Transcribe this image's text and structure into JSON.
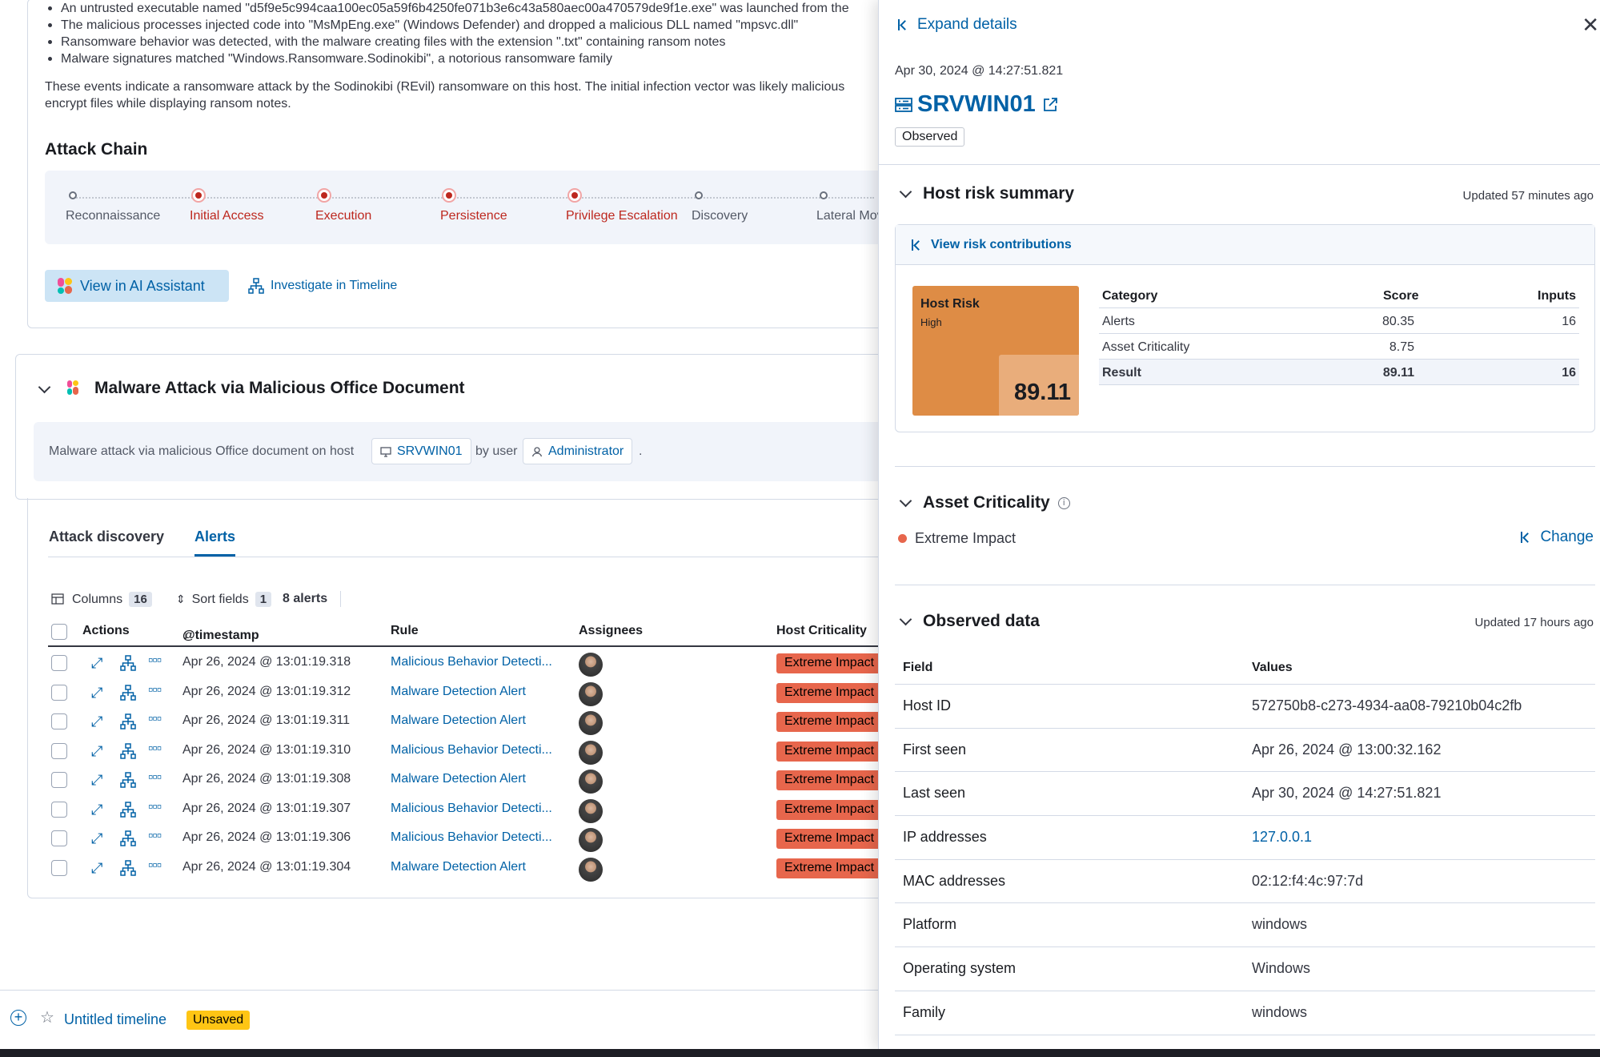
{
  "summary": {
    "bullets": [
      "An untrusted executable named \"d5f9e5c994caa100ec05a59f6b4250fe071b3e6c43a580aec00a470579de9f1e.exe\" was launched from the",
      "The malicious processes injected code into \"MsMpEng.exe\" (Windows Defender) and dropped a malicious DLL named \"mpsvc.dll\"",
      "Ransomware behavior was detected, with the malware creating files with the extension \".txt\" containing ransom notes",
      "Malware signatures matched \"Windows.Ransomware.Sodinokibi\", a notorious ransomware family"
    ],
    "para_line1": "These events indicate a ransomware attack by the Sodinokibi (REvil) ransomware on this host. The initial infection vector was likely malicious",
    "para_line2": "encrypt files while displaying ransom notes."
  },
  "attack_chain": {
    "title": "Attack Chain",
    "stages": [
      {
        "label": "Reconnaissance",
        "active": false
      },
      {
        "label": "Initial Access",
        "active": true
      },
      {
        "label": "Execution",
        "active": true
      },
      {
        "label": "Persistence",
        "active": true
      },
      {
        "label": "Privilege Escalation",
        "active": true
      },
      {
        "label": "Discovery",
        "active": false
      },
      {
        "label": "Lateral Movement",
        "active": false
      }
    ]
  },
  "actions": {
    "ai_assistant": "View in AI Assistant",
    "timeline": "Investigate in Timeline"
  },
  "discovery": {
    "title": "Malware Attack via Malicious Office Document",
    "text_prefix": "Malware attack via malicious Office document on host",
    "host": "SRVWIN01",
    "by_user": "by user",
    "user": "Administrator",
    "text_suffix": "."
  },
  "tabs": {
    "attack_discovery": "Attack discovery",
    "alerts": "Alerts"
  },
  "toolbar": {
    "columns_label": "Columns",
    "columns_count": "16",
    "sort_label": "Sort fields",
    "sort_count": "1",
    "alerts_count": "8 alerts"
  },
  "table": {
    "headers": {
      "actions": "Actions",
      "timestamp": "@timestamp",
      "rule": "Rule",
      "assignees": "Assignees",
      "host_criticality": "Host Criticality"
    },
    "rows": [
      {
        "timestamp": "Apr 26, 2024 @ 13:01:19.318",
        "rule": "Malicious Behavior Detecti...",
        "criticality": "Extreme Impact"
      },
      {
        "timestamp": "Apr 26, 2024 @ 13:01:19.312",
        "rule": "Malware Detection Alert",
        "criticality": "Extreme Impact"
      },
      {
        "timestamp": "Apr 26, 2024 @ 13:01:19.311",
        "rule": "Malware Detection Alert",
        "criticality": "Extreme Impact"
      },
      {
        "timestamp": "Apr 26, 2024 @ 13:01:19.310",
        "rule": "Malicious Behavior Detecti...",
        "criticality": "Extreme Impact"
      },
      {
        "timestamp": "Apr 26, 2024 @ 13:01:19.308",
        "rule": "Malware Detection Alert",
        "criticality": "Extreme Impact"
      },
      {
        "timestamp": "Apr 26, 2024 @ 13:01:19.307",
        "rule": "Malicious Behavior Detecti...",
        "criticality": "Extreme Impact"
      },
      {
        "timestamp": "Apr 26, 2024 @ 13:01:19.306",
        "rule": "Malicious Behavior Detecti...",
        "criticality": "Extreme Impact"
      },
      {
        "timestamp": "Apr 26, 2024 @ 13:01:19.304",
        "rule": "Malware Detection Alert",
        "criticality": "Extreme Impact"
      }
    ]
  },
  "timeline_bar": {
    "title": "Untitled timeline",
    "status": "Unsaved"
  },
  "panel": {
    "expand": "Expand details",
    "timestamp": "Apr 30, 2024 @ 14:27:51.821",
    "host": "SRVWIN01",
    "status": "Observed",
    "risk": {
      "title": "Host risk summary",
      "updated": "Updated 57 minutes ago",
      "view_contributions": "View risk contributions",
      "treemap_title": "Host Risk",
      "treemap_level": "High",
      "treemap_score": "89.11",
      "headers": {
        "category": "Category",
        "score": "Score",
        "inputs": "Inputs"
      },
      "rows": [
        {
          "category": "Alerts",
          "score": "80.35",
          "inputs": "16"
        },
        {
          "category": "Asset Criticality",
          "score": "8.75",
          "inputs": ""
        }
      ],
      "result": {
        "category": "Result",
        "score": "89.11",
        "inputs": "16"
      }
    },
    "criticality": {
      "title": "Asset Criticality",
      "value": "Extreme Impact",
      "change": "Change"
    },
    "observed": {
      "title": "Observed data",
      "updated": "Updated 17 hours ago",
      "headers": {
        "field": "Field",
        "values": "Values"
      },
      "rows": [
        {
          "field": "Host ID",
          "value": "572750b8-c273-4934-aa08-79210b04c2fb"
        },
        {
          "field": "First seen",
          "value": "Apr 26, 2024 @ 13:00:32.162"
        },
        {
          "field": "Last seen",
          "value": "Apr 30, 2024 @ 14:27:51.821"
        },
        {
          "field": "IP addresses",
          "value": "127.0.0.1"
        },
        {
          "field": "MAC addresses",
          "value": "02:12:f4:4c:97:7d"
        },
        {
          "field": "Platform",
          "value": "windows"
        },
        {
          "field": "Operating system",
          "value": "Windows"
        },
        {
          "field": "Family",
          "value": "windows"
        }
      ]
    }
  },
  "colors": {
    "accent": "#0061a6",
    "danger": "#bd271e",
    "extreme": "#e7664c",
    "risk_high": "#de8c45",
    "unsaved": "#fec514"
  }
}
